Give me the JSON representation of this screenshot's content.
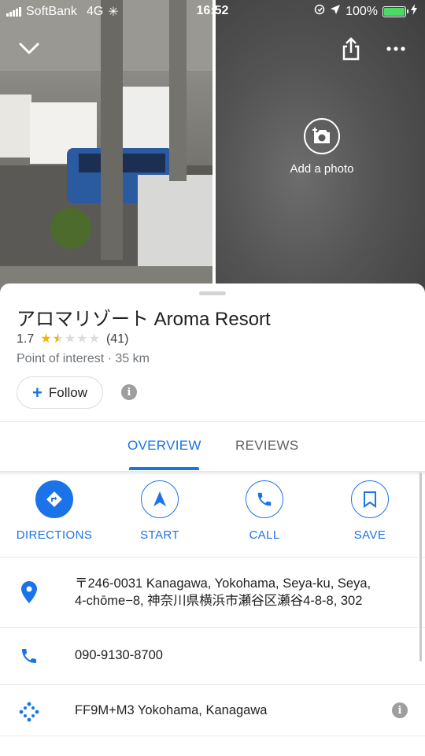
{
  "status_bar": {
    "carrier": "SoftBank",
    "network": "4G",
    "time": "16:52",
    "battery": "100%",
    "battery_level": 1.0
  },
  "photos": {
    "add_photo_label": "Add a photo"
  },
  "place": {
    "name": "アロマリゾート Aroma Resort",
    "rating": "1.7",
    "rating_value": 1.7,
    "review_count": "(41)",
    "subtitle": "Point of interest · 35 km",
    "follow_label": "Follow"
  },
  "tabs": [
    {
      "label": "OVERVIEW",
      "active": true
    },
    {
      "label": "REVIEWS",
      "active": false
    }
  ],
  "actions": [
    {
      "label": "DIRECTIONS",
      "icon": "directions-icon"
    },
    {
      "label": "START",
      "icon": "navigation-arrow-icon"
    },
    {
      "label": "CALL",
      "icon": "phone-icon"
    },
    {
      "label": "SAVE",
      "icon": "bookmark-icon"
    }
  ],
  "details": {
    "address_line1": "〒246-0031 Kanagawa, Yokohama, Seya-ku, Seya,",
    "address_line2": "4-chōme−8, 神奈川県横浜市瀬谷区瀬谷4-8-8, 302",
    "phone": "090-9130-8700",
    "plus_code": "FF9M+M3 Yokohama, Kanagawa"
  },
  "colors": {
    "accent": "#1a73e8",
    "star": "#f4b400",
    "battery": "#4cd964"
  }
}
